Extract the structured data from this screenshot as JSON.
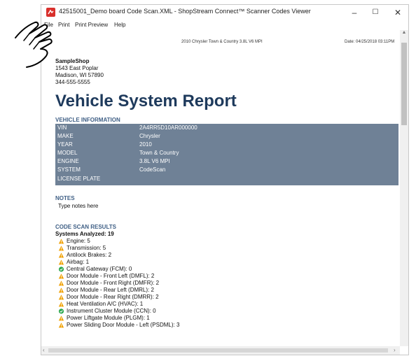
{
  "window": {
    "title": "42515001_Demo board Code Scan.XML - ShopStream Connect™ Scanner Codes Viewer",
    "minimize": "–",
    "maximize": "☐",
    "close": "✕"
  },
  "menu": {
    "file": "File",
    "print": "Print",
    "print_preview": "Print Preview",
    "help": "Help"
  },
  "report": {
    "header_vehicle": "2010 Chrysler Town & Country 3.8L V6 MPI",
    "header_date": "Date: 04/25/2018  03:11PM",
    "shop": {
      "name": "SampleShop",
      "street": "1543 East Poplar",
      "city": "Madison, WI 57890",
      "phone": "344-555-5555"
    },
    "title": "Vehicle System Report",
    "vehicle_info": {
      "heading": "VEHICLE INFORMATION",
      "rows": [
        {
          "label": "VIN",
          "value": "2A4RR5D10AR000000"
        },
        {
          "label": "MAKE",
          "value": "Chrysler"
        },
        {
          "label": "YEAR",
          "value": "2010"
        },
        {
          "label": "MODEL",
          "value": "Town & Country"
        },
        {
          "label": "ENGINE",
          "value": "3.8L V6 MPI"
        },
        {
          "label": "SYSTEM",
          "value": "CodeScan"
        },
        {
          "label": "LICENSE PLATE",
          "value": ""
        }
      ]
    },
    "notes": {
      "heading": "NOTES",
      "text": "Type notes here"
    },
    "code_scan": {
      "heading": "CODE SCAN RESULTS",
      "systems_analyzed": "Systems Analyzed: 19",
      "results": [
        {
          "status": "warning",
          "text": "Engine: 5"
        },
        {
          "status": "warning",
          "text": "Transmission: 5"
        },
        {
          "status": "warning",
          "text": "Antilock Brakes: 2"
        },
        {
          "status": "warning",
          "text": "Airbag: 1"
        },
        {
          "status": "ok",
          "text": "Central Gateway (FCM): 0"
        },
        {
          "status": "warning",
          "text": "Door Module - Front Left (DMFL): 2"
        },
        {
          "status": "warning",
          "text": "Door Module - Front Right (DMFR): 2"
        },
        {
          "status": "warning",
          "text": "Door Module - Rear Left (DMRL): 2"
        },
        {
          "status": "warning",
          "text": "Door Module - Rear Right (DMRR): 2"
        },
        {
          "status": "warning",
          "text": "Heat Ventilation A/C (HVAC): 1"
        },
        {
          "status": "ok",
          "text": "Instrument Cluster Module (CCN): 0"
        },
        {
          "status": "warning",
          "text": "Power Liftgate Module (PLGM): 1"
        },
        {
          "status": "warning",
          "text": "Power Sliding Door Module - Left (PSDML): 3"
        }
      ]
    }
  },
  "colors": {
    "title_blue": "#1e3a5c",
    "section_blue": "#3f5f85",
    "table_bg": "#6f8196",
    "warning": "#f0a30a",
    "ok": "#2fa84f"
  }
}
